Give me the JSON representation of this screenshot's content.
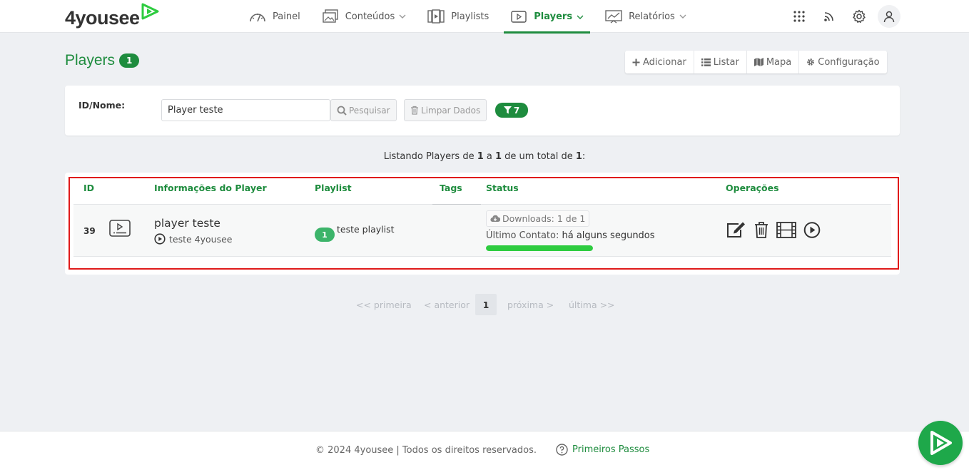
{
  "brand": {
    "logo_text": "4yousee",
    "accent": "#1e8c3e",
    "bright_accent": "#2ecc40"
  },
  "nav": {
    "items": [
      {
        "label": "Painel",
        "icon": "gauge-icon"
      },
      {
        "label": "Conteúdos",
        "icon": "images-icon",
        "has_dropdown": true
      },
      {
        "label": "Playlists",
        "icon": "playlist-icon"
      },
      {
        "label": "Players",
        "icon": "player-screen-icon",
        "has_dropdown": true,
        "active": true
      },
      {
        "label": "Relatórios",
        "icon": "chart-icon",
        "has_dropdown": true
      }
    ]
  },
  "top_icons": [
    "apps-grid-icon",
    "rss-icon",
    "gear-icon",
    "user-icon"
  ],
  "page": {
    "title": "Players",
    "count": "1"
  },
  "actions": {
    "add": "Adicionar",
    "list": "Listar",
    "map": "Mapa",
    "config": "Configuração"
  },
  "search": {
    "label": "ID/Nome:",
    "value": "Player teste",
    "search_button": "Pesquisar",
    "clear_button": "Limpar Dados",
    "filter_count": "7"
  },
  "listing": {
    "prefix": "Listando Players de ",
    "from": "1",
    "sep": " a ",
    "to": "1",
    "mid": " de um total de ",
    "total": "1",
    "suffix": ":"
  },
  "table": {
    "headers": {
      "id": "ID",
      "info": "Informações do Player",
      "playlist": "Playlist",
      "tags": "Tags",
      "status": "Status",
      "operations": "Operações"
    },
    "rows": [
      {
        "id": "39",
        "name": "player teste",
        "sub": "teste 4yousee",
        "playlist_count": "1",
        "playlist_name": "teste playlist",
        "downloads": "Downloads: 1 de 1",
        "contact_label": "Último Contato:",
        "contact_value": "há alguns segundos",
        "status_level": 1.0,
        "operations": [
          "edit-icon",
          "trash-icon",
          "film-icon",
          "play-circle-icon"
        ]
      }
    ]
  },
  "pagination": {
    "first": "<< primeira",
    "prev": "< anterior",
    "current": "1",
    "next": "próxima >",
    "last": "última >>"
  },
  "footer": {
    "copyright": "© 2024 4yousee | Todos os direitos reservados.",
    "help": "Primeiros Passos"
  }
}
